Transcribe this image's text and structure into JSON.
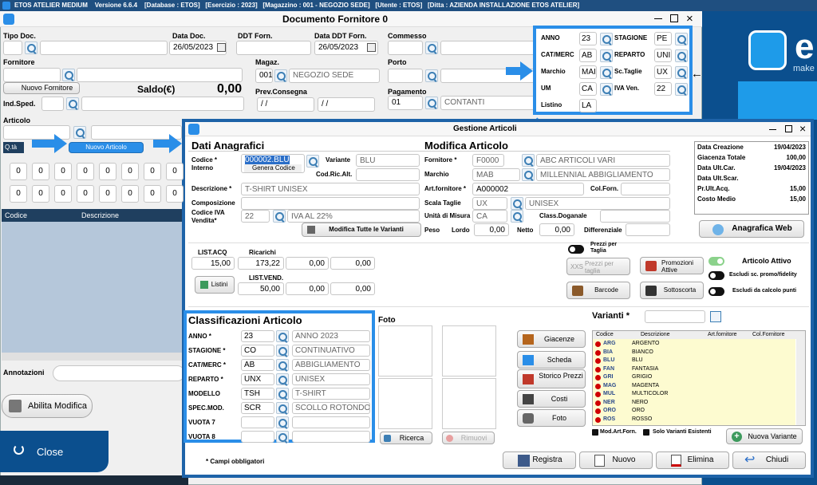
{
  "appbar": {
    "app": "ETOS ATELIER MEDIUM",
    "version": "Versione 6.6.4",
    "database": "[Database : ETOS]",
    "esercizio": "[Esercizio : 2023]",
    "magazzino": "[Magazzino : 001 - NEGOZIO SEDE]",
    "utente": "[Utente : ETOS]",
    "ditta": "[Ditta : AZIENDA INSTALLAZIONE ETOS ATELIER]"
  },
  "fornitore_window": {
    "title": "Documento Fornitore 0",
    "tipo_doc": "Tipo Doc.",
    "data_doc": "Data Doc.",
    "data_doc_value": "26/05/2023",
    "ddt_forn": "DDT Forn.",
    "data_ddt_forn": "Data DDT Forn.",
    "data_ddt_value": "26/05/2023",
    "commesso": "Commesso",
    "fornitore": "Fornitore",
    "magaz": "Magaz.",
    "magaz_code": "001",
    "magaz_name": "NEGOZIO SEDE",
    "porto": "Porto",
    "nuovo_fornitore": "Nuovo Fornitore",
    "saldo": "Saldo(€)",
    "saldo_value": "0,00",
    "ind_sped": "Ind.Sped.",
    "prev_consegna": "Prev.Consegna",
    "prev_value": "/ /",
    "prev_value2": "/ /",
    "pagamento": "Pagamento",
    "pagamento_code": "01",
    "pagamento_name": "CONTANTI",
    "articolo": "Articolo",
    "qta": "Q.tà",
    "nuovo_articolo": "Nuovo Articolo",
    "col_codice": "Codice",
    "col_descrizione": "Descrizione",
    "annotazioni": "Annotazioni",
    "abilita_modifica": "Abilita Modifica",
    "close": "Close",
    "zeros": [
      "0",
      "0",
      "0",
      "0",
      "0",
      "0",
      "0",
      "0",
      "0",
      "0",
      "0",
      "0",
      "0",
      "0",
      "0",
      "0"
    ]
  },
  "callout_top": {
    "anno_l": "ANNO",
    "anno": "23",
    "stagione_l": "STAGIONE",
    "stagione": "PE",
    "catmerc_l": "CAT/MERC",
    "catmerc": "AB",
    "reparto_l": "REPARTO",
    "reparto": "UNI",
    "marchio_l": "Marchio",
    "marchio": "MAI",
    "sctaglie_l": "Sc.Taglie",
    "sctaglie": "UX",
    "um_l": "UM",
    "um": "CA",
    "ivaven_l": "IVA Ven.",
    "ivaven": "22",
    "listino_l": "Listino",
    "listino": "LA"
  },
  "brand": {
    "word": "e",
    "sub": "make"
  },
  "articoli": {
    "title": "Gestione Articoli",
    "dati_anag": "Dati Anagrafici",
    "modifica": "Modifica Articolo",
    "codice_l": "Codice * Interno",
    "codice": "000002.BLU",
    "genera": "Genera Codice",
    "variante_l": "Variante",
    "variante": "BLU",
    "cod_ric_alt": "Cod.Ric.Alt.",
    "fornitore_l": "Fornitore *",
    "fornitore_code": "F0000",
    "fornitore_name": "ABC ARTICOLI VARI",
    "marchio_l": "Marchio",
    "marchio_code": "MAB",
    "marchio_name": "MILLENNIAL ABBIGLIAMENTO",
    "art_forn_l": "Art.fornitore *",
    "art_forn": "A000002",
    "col_forn": "Col.Forn.",
    "descrizione_l": "Descrizione *",
    "descrizione": "T-SHIRT UNISEX",
    "scala_l": "Scala Taglie",
    "scala_code": "UX",
    "scala_name": "UNISEX",
    "composizione_l": "Composizione",
    "iva_l": "Codice IVA Vendita*",
    "iva_code": "22",
    "iva_name": "IVA AL 22%",
    "um_l": "Unità di Misura",
    "um": "CA",
    "class_dog": "Class.Doganale",
    "modifica_varianti": "Modifica Tutte le Varianti",
    "peso": "Peso",
    "lordo": "Lordo",
    "lordo_val": "0,00",
    "netto": "Netto",
    "netto_val": "0,00",
    "differenziale": "Differenziale",
    "info": [
      {
        "k": "Data Creazione",
        "v": "19/04/2023"
      },
      {
        "k": "Giacenza Totale",
        "v": "100,00"
      },
      {
        "k": "Data Ult.Car.",
        "v": "19/04/2023"
      },
      {
        "k": "Data Ult.Scar.",
        "v": ""
      },
      {
        "k": "Pr.Ult.Acq.",
        "v": "15,00"
      },
      {
        "k": "Costo Medio",
        "v": "15,00"
      }
    ],
    "anagrafica_web": "Anagrafica Web",
    "list_acq": "LIST.ACQ",
    "list_acq_val": "15,00",
    "ricarichi": "Ricarichi",
    "ric1": "173,22",
    "ric2": "0,00",
    "ric3": "0,00",
    "listini": "Listini",
    "list_vend": "LIST.VEND.",
    "lv1": "50,00",
    "lv2": "0,00",
    "lv3": "0,00",
    "prezzi_taglia": "Prezzi per Taglia",
    "xxs": "XXS",
    "prezzi_taglia_btn": "Prezzi per taglia",
    "promozioni": "Promozioni Attive",
    "articolo_attivo": "Articolo Attivo",
    "escludi_promo": "Escludi sc. promo/fidelity",
    "barcode": "Barcode",
    "sottoscorta": "Sottoscorta",
    "escludi_punti": "Escludi da calcolo punti",
    "classif_title": "Classificazioni Articolo",
    "classif": [
      {
        "l": "ANNO *",
        "c": "23",
        "n": "ANNO 2023"
      },
      {
        "l": "STAGIONE *",
        "c": "CO",
        "n": "CONTINUATIVO"
      },
      {
        "l": "CAT/MERC *",
        "c": "AB",
        "n": "ABBIGLIAMENTO"
      },
      {
        "l": "REPARTO *",
        "c": "UNX",
        "n": "UNISEX"
      },
      {
        "l": "MODELLO",
        "c": "TSH",
        "n": "T-SHIRT"
      },
      {
        "l": "SPEC.MOD.",
        "c": "SCR",
        "n": "SCOLLO ROTONDO"
      },
      {
        "l": "VUOTA 7",
        "c": "",
        "n": ""
      },
      {
        "l": "VUOTA 8",
        "c": "",
        "n": ""
      }
    ],
    "foto": "Foto",
    "ricerca": "Ricerca",
    "rimuovi": "Rimuovi",
    "giacenze": "Giacenze",
    "scheda": "Scheda",
    "storico": "Storico Prezzi",
    "costi": "Costi",
    "foto_btn": "Foto",
    "varianti": "Varianti *",
    "var_cols": [
      "Codice",
      "Descrizione",
      "Art.fornitore",
      "Col.Fornitore"
    ],
    "var_rows": [
      {
        "c": "ARG",
        "d": "ARGENTO"
      },
      {
        "c": "BIA",
        "d": "BIANCO"
      },
      {
        "c": "BLU",
        "d": "BLU"
      },
      {
        "c": "FAN",
        "d": "FANTASIA"
      },
      {
        "c": "GRI",
        "d": "GRIGIO"
      },
      {
        "c": "MAG",
        "d": "MAGENTA"
      },
      {
        "c": "MUL",
        "d": "MULTICOLOR"
      },
      {
        "c": "NER",
        "d": "NERO"
      },
      {
        "c": "ORO",
        "d": "ORO"
      },
      {
        "c": "ROS",
        "d": "ROSSO"
      }
    ],
    "mod_art_forn": "Mod.Art.Forn.",
    "solo_varianti": "Solo Varianti Esistenti",
    "nuova_variante": "Nuova Variante",
    "campi_obb": "* Campi obbligatori",
    "registra": "Registra",
    "nuovo": "Nuovo",
    "elimina": "Elimina",
    "chiudi": "Chiudi"
  }
}
